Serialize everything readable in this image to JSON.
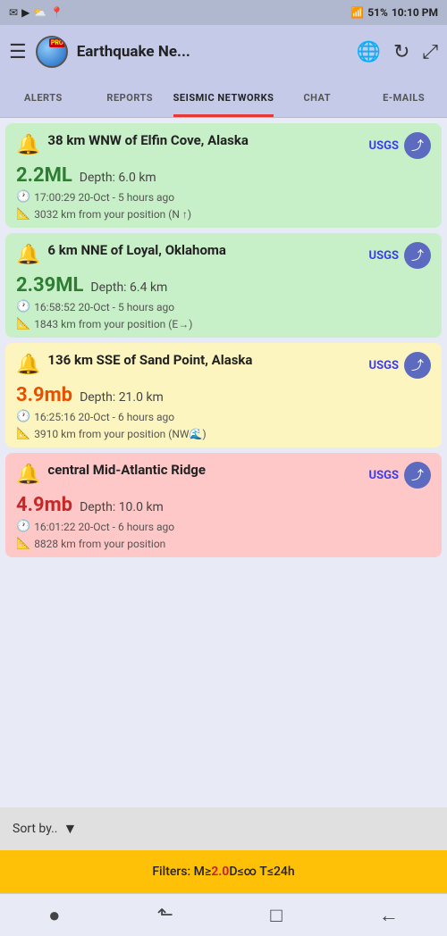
{
  "status_bar": {
    "left_icons": [
      "✉",
      "▶",
      "☁"
    ],
    "right": "10:10 PM",
    "battery": "51%",
    "signal": "▲▲▲▲"
  },
  "app_bar": {
    "title": "Earthquake Ne...",
    "menu_icon": "☰",
    "globe_icon": "🌐",
    "refresh_icon": "↻",
    "expand_icon": "⤢"
  },
  "tabs": [
    {
      "id": "alerts",
      "label": "ALERTS",
      "active": false
    },
    {
      "id": "reports",
      "label": "REPORTS",
      "active": false
    },
    {
      "id": "seismic",
      "label": "SEISMIC NETWORKS",
      "active": true
    },
    {
      "id": "chat",
      "label": "CHAT",
      "active": false
    },
    {
      "id": "emails",
      "label": "E-MAILS",
      "active": false
    }
  ],
  "earthquakes": [
    {
      "color": "green",
      "title": "38 km WNW of Elfin Cove, Alaska",
      "magnitude": "2.2",
      "mag_unit": "ML",
      "mag_color": "green-text",
      "depth": "Depth: 6.0 km",
      "time": "17:00:29 20-Oct - 5 hours ago",
      "distance": "3032 km from your position (N ↑)",
      "source": "USGS"
    },
    {
      "color": "green",
      "title": "6 km NNE of Loyal, Oklahoma",
      "magnitude": "2.39",
      "mag_unit": "ML",
      "mag_color": "green-text",
      "depth": "Depth: 6.4 km",
      "time": "16:58:52 20-Oct - 5 hours ago",
      "distance": "1843 km from your position (E→)",
      "source": "USGS"
    },
    {
      "color": "yellow",
      "title": "136 km SSE of Sand Point, Alaska",
      "magnitude": "3.9",
      "mag_unit": "mb",
      "mag_color": "orange-text",
      "depth": "Depth: 21.0 km",
      "time": "16:25:16 20-Oct - 6 hours ago",
      "distance": "3910 km from your position (NW🌊)",
      "source": "USGS"
    },
    {
      "color": "red",
      "title": "central Mid-Atlantic Ridge",
      "magnitude": "4.9",
      "mag_unit": "mb",
      "mag_color": "red-text",
      "depth": "Depth: 10.0 km",
      "time": "16:01:22 20-Oct - 6 hours ago",
      "distance": "8828 km from your position",
      "source": "USGS"
    }
  ],
  "sort_bar": {
    "label": "Sort by..",
    "dropdown_icon": "▼"
  },
  "filter_bar": {
    "prefix": "Filters: M≥",
    "magnitude": "2.0",
    "suffix": " D≤∞ T≤24h"
  },
  "bottom_nav": [
    "●",
    "⬑",
    "□",
    "←"
  ]
}
